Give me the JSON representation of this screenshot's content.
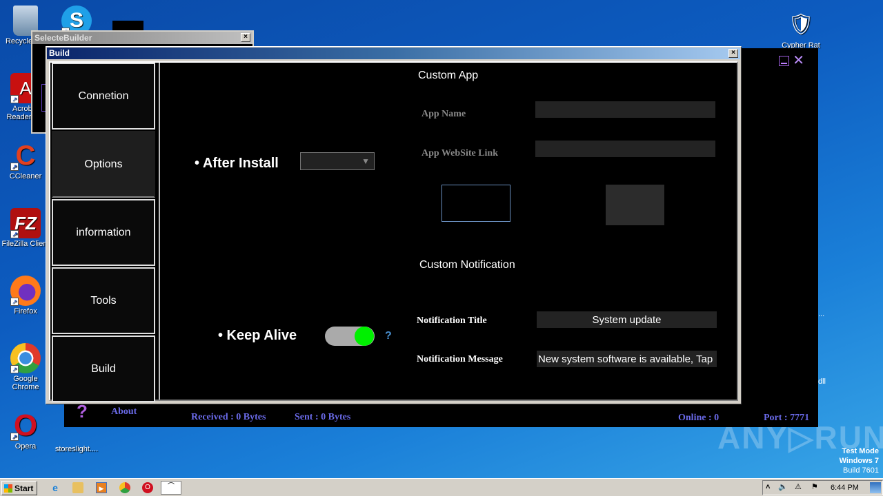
{
  "desktop": {
    "icons": [
      {
        "label": "Recycle Bin",
        "glyph": "🗑",
        "color": "#7aa0c0"
      },
      {
        "label": "Skype",
        "glyph": "S",
        "color": "#1fa0e8"
      },
      {
        "label": "Acrobat Reader DC",
        "glyph": "A",
        "color": "#d01010"
      },
      {
        "label": "CCleaner",
        "glyph": "C",
        "color": "#e04020"
      },
      {
        "label": "FileZilla Client",
        "glyph": "FZ",
        "color": "#b01010"
      },
      {
        "label": "Firefox",
        "glyph": "🦊",
        "color": "#ff7a1a"
      },
      {
        "label": "Google Chrome",
        "glyph": "◉",
        "color": "#3a8ee0"
      },
      {
        "label": "Opera",
        "glyph": "O",
        "color": "#d01020"
      },
      {
        "label": "Cypher Rat",
        "glyph": "🛡",
        "color": "#d0c090"
      },
      {
        "label": "storeslight....",
        "glyph": "",
        "color": "#4aa0d8"
      }
    ],
    "partial_labels": [
      "...",
      "dll"
    ],
    "watermark": "ANY▷RUN",
    "os_info": [
      "Test Mode",
      "Windows 7",
      "Build 7601"
    ]
  },
  "selecte_window": {
    "title": "SelecteBuilder",
    "close_label": "×"
  },
  "cypher_window": {
    "about_label": "About",
    "received": "Received : 0 Bytes",
    "sent": "Sent : 0 Bytes",
    "online": "Online : 0",
    "port": "Port : 7771",
    "close_glyph": "✕"
  },
  "build_window": {
    "title": "Build",
    "close_label": "×",
    "nav": [
      {
        "label": "Connetion",
        "active": false
      },
      {
        "label": "Options",
        "active": true
      },
      {
        "label": "information",
        "active": false
      },
      {
        "label": "Tools",
        "active": false
      },
      {
        "label": "Build",
        "active": false
      }
    ],
    "options": {
      "after_install_label": "• After Install",
      "after_install_value": "",
      "keep_alive_label": "• Keep Alive",
      "keep_alive_on": true,
      "help_label": "?",
      "custom_app": {
        "title": "Custom App",
        "app_name_label": "App Name",
        "app_name_value": "",
        "app_link_label": "App WebSite Link",
        "app_link_value": ""
      },
      "custom_notification": {
        "title": "Custom Notification",
        "notif_title_label": "Notification Title",
        "notif_title_value": "System update",
        "notif_msg_label": "Notification Message",
        "notif_msg_value": "New system software is available, Tap"
      }
    }
  },
  "taskbar": {
    "start_label": "Start",
    "clock": "6:44 PM",
    "tray_icons": [
      "chevron-up",
      "speaker",
      "network-warning",
      "flag"
    ]
  },
  "colors": {
    "status_text": "#6a6ae8",
    "toggle_on": "#00f000",
    "accent_purple": "#b060e0"
  }
}
